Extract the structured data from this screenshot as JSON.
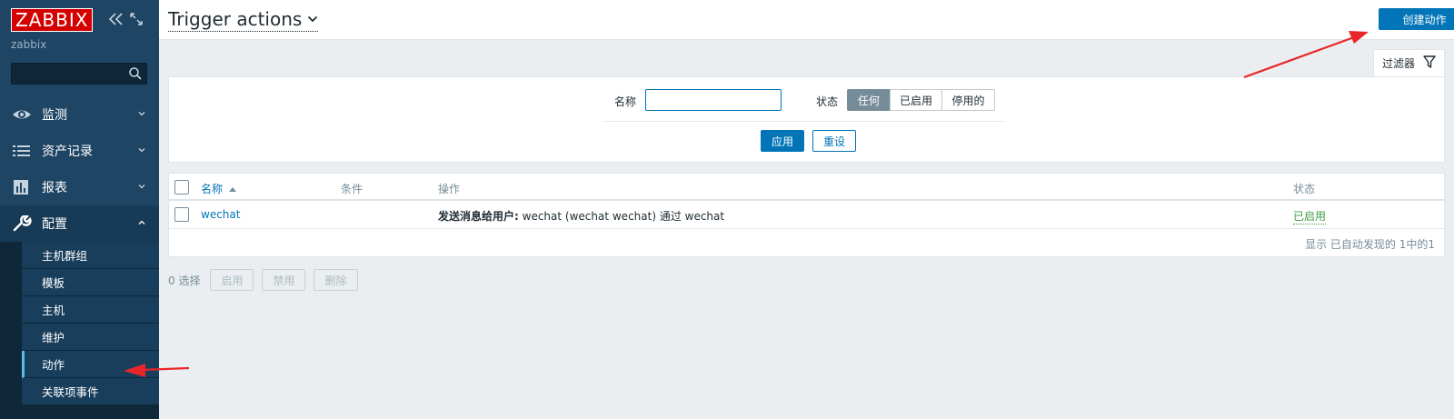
{
  "sidebar": {
    "logo": "ZABBIX",
    "server_name": "zabbix",
    "search_placeholder": "",
    "menu": [
      {
        "label": "监测",
        "icon": "eye-icon"
      },
      {
        "label": "资产记录",
        "icon": "list-icon"
      },
      {
        "label": "报表",
        "icon": "bar-chart-icon"
      },
      {
        "label": "配置",
        "icon": "wrench-icon"
      }
    ],
    "submenu": [
      {
        "label": "主机群组"
      },
      {
        "label": "模板"
      },
      {
        "label": "主机"
      },
      {
        "label": "维护"
      },
      {
        "label": "动作"
      },
      {
        "label": "关联项事件"
      }
    ]
  },
  "header": {
    "title": "Trigger actions",
    "create_button": "创建动作"
  },
  "filter": {
    "tab_label": "过滤器",
    "name_label": "名称",
    "name_value": "",
    "status_label": "状态",
    "status_options": [
      "任何",
      "已启用",
      "停用的"
    ],
    "status_selected": "任何",
    "apply_label": "应用",
    "reset_label": "重设"
  },
  "table": {
    "columns": {
      "name": "名称",
      "conditions": "条件",
      "operations": "操作",
      "status": "状态"
    },
    "rows": [
      {
        "name": "wechat",
        "conditions": "",
        "operations_prefix": "发送消息给用户:",
        "operations_text": "wechat (wechat wechat) 通过 wechat",
        "status": "已启用"
      }
    ],
    "footer": "显示 已自动发现的 1中的1"
  },
  "mass_actions": {
    "selected_count": "0 选择",
    "enable": "启用",
    "disable": "禁用",
    "delete": "删除"
  },
  "colors": {
    "sidebar_bg": "#1f4564",
    "accent": "#0275b8",
    "enabled_green": "#429e47",
    "annotation_red": "#e8262a"
  }
}
